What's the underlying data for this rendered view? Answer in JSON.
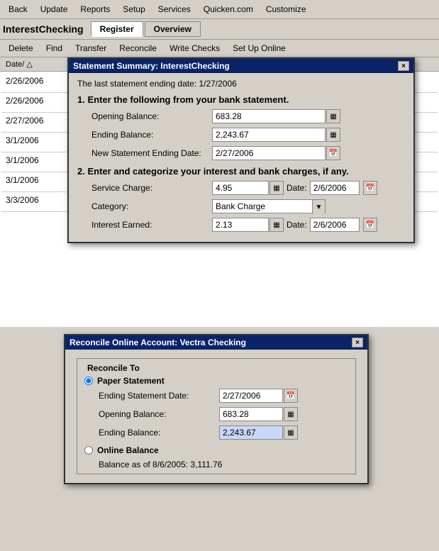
{
  "menu": {
    "items": [
      "Back",
      "Update",
      "Reports",
      "Setup",
      "Services",
      "Quicken.com",
      "Customize"
    ]
  },
  "account": {
    "title": "InterestChecking",
    "tabs": [
      "Register",
      "Overview"
    ]
  },
  "submenu": {
    "items": [
      "Delete",
      "Find",
      "Transfer",
      "Reconcile",
      "Write Checks",
      "Set Up Online"
    ]
  },
  "register": {
    "col_header": "Date/ △",
    "dates": [
      "2/26/2006",
      "2/26/2006",
      "2/27/2006",
      "3/1/2006",
      "3/1/2006",
      "3/1/2006",
      "3/3/2006"
    ]
  },
  "statement_dialog": {
    "title": "Statement Summary: InterestChecking",
    "last_statement": "The last statement ending date:  1/27/2006",
    "section1_header": "1.  Enter the following from your bank statement.",
    "opening_balance_label": "Opening Balance:",
    "opening_balance_value": "683.28",
    "ending_balance_label": "Ending Balance:",
    "ending_balance_value": "2,243.67",
    "new_ending_date_label": "New Statement Ending Date:",
    "new_ending_date_value": "2/27/2006",
    "section2_header": "2.  Enter and categorize your interest and bank charges, if any.",
    "service_charge_label": "Service Charge:",
    "service_charge_value": "4.95",
    "service_charge_date_label": "Date:",
    "service_charge_date_value": "2/6/2006",
    "category_label": "Category:",
    "category_value": "Bank Charge",
    "interest_earned_label": "Interest Earned:",
    "interest_earned_value": "2.13",
    "interest_date_label": "Date:",
    "interest_date_value": "2/6/2006",
    "close_btn": "×"
  },
  "reconcile_dialog": {
    "title": "Reconcile Online Account: Vectra Checking",
    "close_btn": "×",
    "group_title": "Reconcile To",
    "paper_statement_label": "Paper Statement",
    "ending_statement_date_label": "Ending Statement Date:",
    "ending_statement_date_value": "2/27/2006",
    "opening_balance_label": "Opening Balance:",
    "opening_balance_value": "683.28",
    "ending_balance_label": "Ending Balance:",
    "ending_balance_value": "2,243.67",
    "online_balance_label": "Online Balance",
    "balance_as_of_label": "Balance as of 8/6/2005:  3,111.76"
  }
}
